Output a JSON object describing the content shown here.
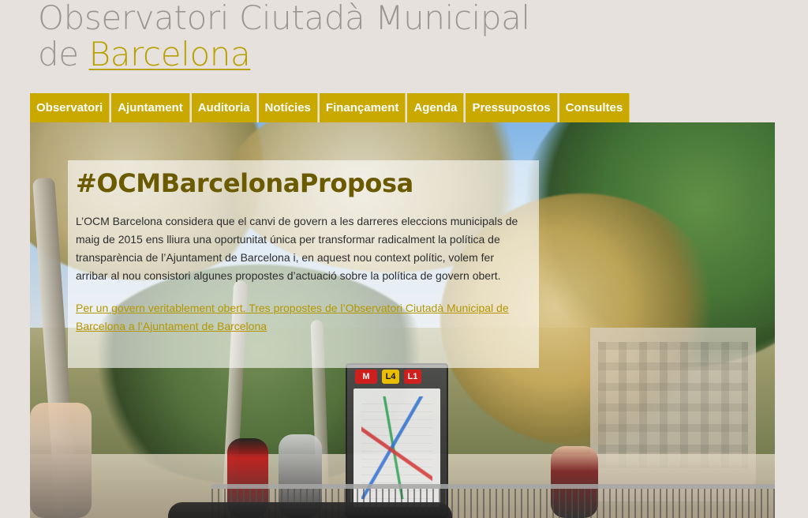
{
  "header": {
    "title_line1": "Observatori Ciutadà Municipal",
    "title_line2_prefix": "de ",
    "title_line2_link": "Barcelona"
  },
  "nav": {
    "items": [
      "Observatori",
      "Ajuntament",
      "Auditoria",
      "Notícies",
      "Finançament",
      "Agenda",
      "Pressupostos",
      "Consultes"
    ]
  },
  "hero": {
    "heading": "#OCMBarcelonaProposa",
    "body": "L’OCM Barcelona considera que el canvi de govern a les darreres eleccions municipals de maig de 2015 ens lliura una oportunitat única per transformar radicalment la política de transparència de l’Ajuntament de Barcelona i, en aquest nou context polític, volem fer arribar al nou consistori algunes propostes d’actuació sobre la política de govern obert.",
    "link": "Per un govern veritablement obert. Tres propostes de l’Observatori Ciutadà Municipal de Barcelona a l’Ajuntament de Barcelona",
    "metro_badges": [
      "M",
      "L4",
      "L1"
    ]
  },
  "colors": {
    "page_bg": "#e6e1dc",
    "nav_bg": "#c9a800",
    "accent_link": "#b49600",
    "title_gray": "#9a9793",
    "hero_heading": "#6b5a00"
  }
}
